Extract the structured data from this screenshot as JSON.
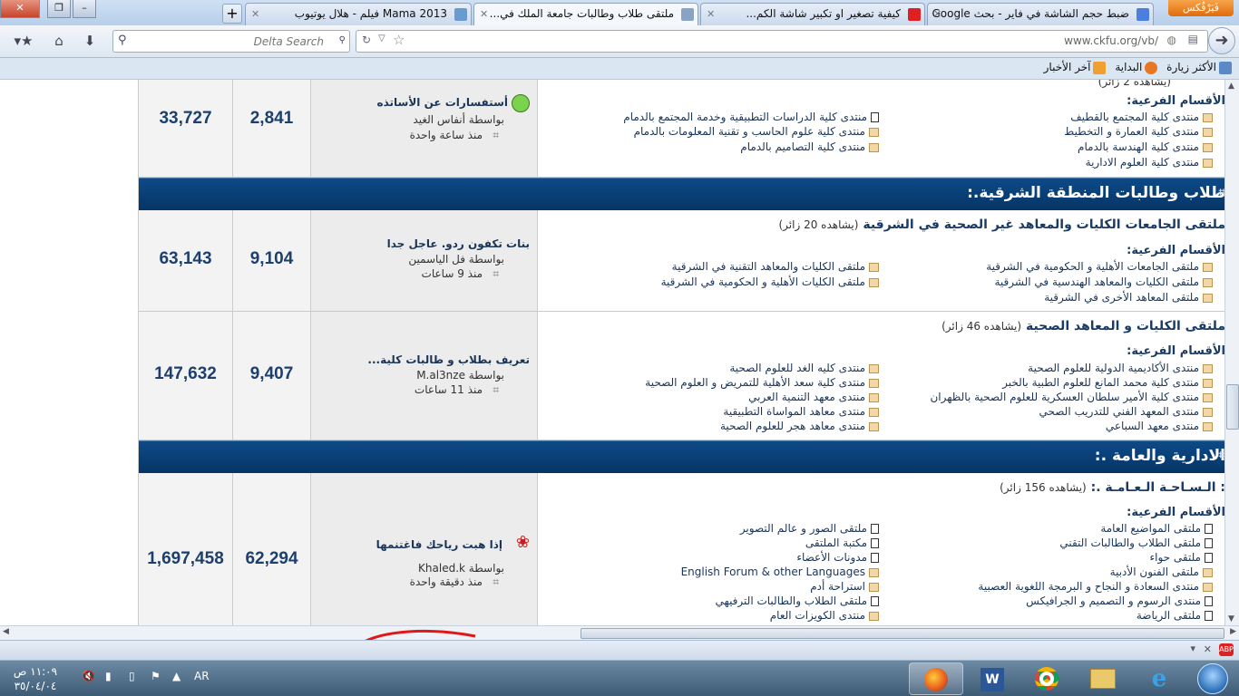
{
  "browser": {
    "firefox_button": "فَيَرْفُكس",
    "tabs": [
      {
        "label": "ضبط حجم الشاشة في فاير - بحث Google",
        "favicon_color": "#4a7fe0"
      },
      {
        "label": "كيفية تصغير او تكبير شاشة الكم...",
        "favicon_color": "#e02020"
      },
      {
        "label": "ملتقى طلاب وطالبات جامعة الملك في...",
        "favicon_color": "#8aa3c3",
        "active": true
      },
      {
        "label": "Mama 2013 فيلم - هلال يوتيوب",
        "favicon_color": "#6a9bd0"
      }
    ],
    "new_tab": "+",
    "search_placeholder": "Delta Search",
    "url": "www.ckfu.org/vb/",
    "bookmarks": [
      {
        "label": "الأكثر زيارة",
        "icon_color": "#5a8ac6"
      },
      {
        "label": "البداية",
        "icon_color": "#e87722"
      },
      {
        "label": "آخر الأخبار",
        "icon_color": "#f0a030"
      }
    ]
  },
  "forum": {
    "top_partial_row": {
      "posts": "33,727",
      "threads": "2,841",
      "last_post": {
        "title": "أستفسارات عن الأساتذه",
        "by": "بواسطة أنفاس الغيد",
        "time": "منذ ساعة واحدة"
      },
      "header_partial": "(يشاهده 2 زائر)",
      "subforums_heading": "الأقسام الفرعية:",
      "subforums_right": [
        "منتدى كلية المجتمع بالقطيف",
        "منتدى كلية العمارة و التخطيط",
        "منتدى كلية الهندسة بالدمام",
        "منتدى كلية العلوم الادارية"
      ],
      "subforums_left": [
        "منتدى كلية الدراسات التطبيقية وخدمة المجتمع بالدمام",
        "منتدى كلية علوم الحاسب و تقنية المعلومات بالدمام",
        "منتدى كلية التصاميم بالدمام"
      ]
    },
    "category_eastern": {
      "title": "طلاب وطالبات المنطقة الشرقية.:"
    },
    "row_universities": {
      "name": "ملتقى الجامعات الكليات والمعاهد غير الصحية في الشرقية",
      "viewers": "(يشاهده 20 زائر)",
      "subforums_heading": "الأقسام الفرعية:",
      "subforums_right": [
        "ملتقى الجامعات الأهلية و الحكومية في الشرقية",
        "ملتقى الكليات والمعاهد الهندسية في الشرقية",
        "ملتقى المعاهد الأخرى في الشرقية"
      ],
      "subforums_left": [
        "ملتقى الكليات والمعاهد التقنية في الشرقية",
        "ملتقى الكليات الأهلية و الحكومية في الشرقية"
      ],
      "threads": "9,104",
      "posts": "63,143",
      "last_post": {
        "title": "بنات تكفون ردو. عاجل جدا",
        "by": "بواسطة فل الياسمين",
        "time": "منذ 9 ساعات"
      }
    },
    "row_health": {
      "name": "ملتقى الكليات و المعاهد الصحية",
      "viewers": "(يشاهده 46 زائر)",
      "subforums_heading": "الأقسام الفرعية:",
      "subforums_right": [
        "منتدى الأكاديمية الدولية للعلوم الصحية",
        "منتدى كلية محمد المانع للعلوم الطبية بالخبر",
        "منتدى كلية الأمير سلطان العسكرية للعلوم الصحية بالظهران",
        "منتدى المعهد الفني للتدريب الصحي",
        "منتدى معهد السباعي"
      ],
      "subforums_left": [
        "منتدى كليه الغد للعلوم الصحية",
        "منتدى كلية سعد الأهلية للتمريض و العلوم الصحية",
        "منتدى معهد التنمية العربي",
        "منتدى معاهد المواساة التطبيقية",
        "منتدى معاهد هجر للعلوم الصحية"
      ],
      "threads": "9,407",
      "posts": "147,632",
      "last_post": {
        "title": "تعريف بطلاب و طالبات كلية...",
        "by": "بواسطة M.al3nze",
        "time": "منذ 11 ساعات"
      }
    },
    "category_admin": {
      "title": "الادارية والعامة .:"
    },
    "row_general": {
      "name": ": الـسـاحـة الـعـامـة .:",
      "viewers": "(يشاهده 156 زائر)",
      "subforums_heading": "الأقسام الفرعية:",
      "subforums_right": [
        "ملتقى المواضيع العامة",
        "ملتقى الطلاب والطالبات التقني",
        "ملتقى حواء",
        "ملتقى الفنون الأدبية",
        "منتدى السعادة و النجاح و البرمجة اللغوية العصبية",
        "منتدى الرسوم و التصميم و الجرافيكس",
        "ملتقى الرياضة"
      ],
      "subforums_left": [
        "ملتقى الصور و عالم التصوير",
        "مكتبة الملتقى",
        "مدونات الأعضاء",
        "English Forum & other Languages",
        "استراحة أدم",
        "ملتقى الطلاب والطالبات الترفيهي",
        "منتدى الكويزات العام"
      ],
      "threads": "62,294",
      "posts": "1,697,458",
      "last_post": {
        "title": "إذا هبت رياحك فاغتنمها",
        "by": "بواسطة Khaled.k",
        "time": "منذ دقيقة واحدة"
      }
    }
  },
  "taskbar": {
    "clock_time": "١١:٠٩ ص",
    "clock_date": "٣٥/٠٤/٠٤",
    "language": "AR"
  }
}
